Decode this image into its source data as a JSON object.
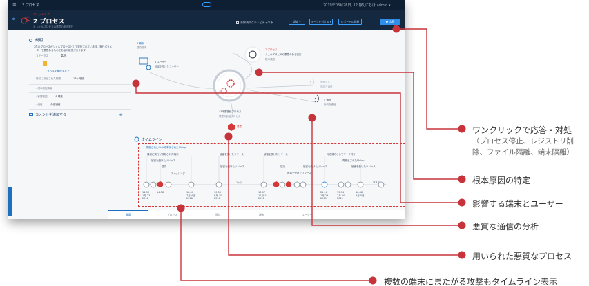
{
  "app": {
    "topbar_title": "2 プロセス",
    "datetime": "2019年03月26日, 12:06",
    "greeting": "こんにちは admin ▾"
  },
  "header": {
    "back": "«",
    "subtitle": "フィッシング",
    "title": "2 プロセス",
    "description": "① シェルプロセスの悪意のある実行",
    "checkbox_label": "未解決アクティビティのみ",
    "buttons": [
      "調査 ▾",
      "マークを付ける ▾",
      "レポートの印刷"
    ],
    "action_button": "✿ 応答"
  },
  "description": {
    "heading": "説明",
    "bullet": "2件のプロセスがシェルプロセスとして実行されています。実行パラメーターで悪意あるものである可能性があります。",
    "status_label": "ステータス",
    "status_value": "高/低",
    "label_link": "ラベルを管理する ▾",
    "first_detected_label": "最初に検出された期間",
    "first_detected_value": "16ヶ月前",
    "rows": [
      {
        "label": "根本原因情報"
      },
      {
        "label": "影響範囲",
        "value": "8 端末"
      },
      {
        "label": "通信",
        "value": "外部通信"
      }
    ],
    "comment": "コメントを追加する",
    "plus": "+"
  },
  "graph": {
    "endpoints_label": "8 端末",
    "endpoints_sub": "感染端末",
    "users_label": "8 ユーザー",
    "users_sub": "被害を受けたユーザー",
    "root_cause_top": "2 プロセス",
    "root_cause_label": "シェルプロセスの悪意のある実行",
    "root_cause_sub": "根本原因",
    "conn_none": "通信なし",
    "conn_none_sub": "内向き通信",
    "conn_count": "4 通信",
    "conn_sub": "外向き通信",
    "malproc_label": "43不審審議プロセス",
    "malproc_sub": "悪意のあるプロセス",
    "malproc_badge": "悪意"
  },
  "timeline": {
    "heading": "タイムライン",
    "top_label": "開始されたMalo攻撃化されたMalop",
    "events": [
      "最初に実行が検知された端末",
      "被害を受けたリソース",
      "感染",
      "フィッシング",
      "被害を受けたリソース",
      "被害を受けたリソース",
      "被害を受けたリソース",
      "感染",
      "被害を受けたリソース",
      "被害を受けたリソース",
      "対応済みとしてマーク付け",
      "再検出されたMalop",
      "被害を受けたリソース",
      "今すぐ"
    ],
    "gap": "3ヶ月",
    "times": [
      {
        "t": "14:53",
        "d": "1月 23",
        "y": "2018"
      },
      {
        "t": "14:58",
        "d": "",
        "y": ""
      },
      {
        "t": "18:00",
        "d": "7月 4日",
        "y": "2018"
      },
      {
        "t": "10:55",
        "d": "8月 30",
        "y": "2018"
      },
      {
        "t": "10:07",
        "d": "12月 14",
        "y": "2018"
      },
      {
        "t": "21:18",
        "d": "1月 29",
        "y": "2019"
      },
      {
        "t": "15:34",
        "d": "2月 20",
        "y": "2019"
      },
      {
        "t": "18:48",
        "d": "3月 5日",
        "y": ""
      }
    ]
  },
  "tabs": [
    "概要",
    "プロセス",
    "通信",
    "端末",
    "ユーザー"
  ],
  "annotations": [
    {
      "label": "ワンクリックで応答・対処",
      "sub": "（プロセス停止、レジストリ削除、ファイル隔離、端末隔離）"
    },
    {
      "label": "根本原因の特定"
    },
    {
      "label": "影響する端末とユーザー"
    },
    {
      "label": "悪質な通信の分析"
    },
    {
      "label": "用いられた悪質なプロセス"
    },
    {
      "label": "複数の端末にまたがる攻撃もタイムライン表示"
    }
  ],
  "colors": {
    "accent": "#d43838",
    "primary": "#1f6fc0",
    "navy": "#14283f"
  }
}
